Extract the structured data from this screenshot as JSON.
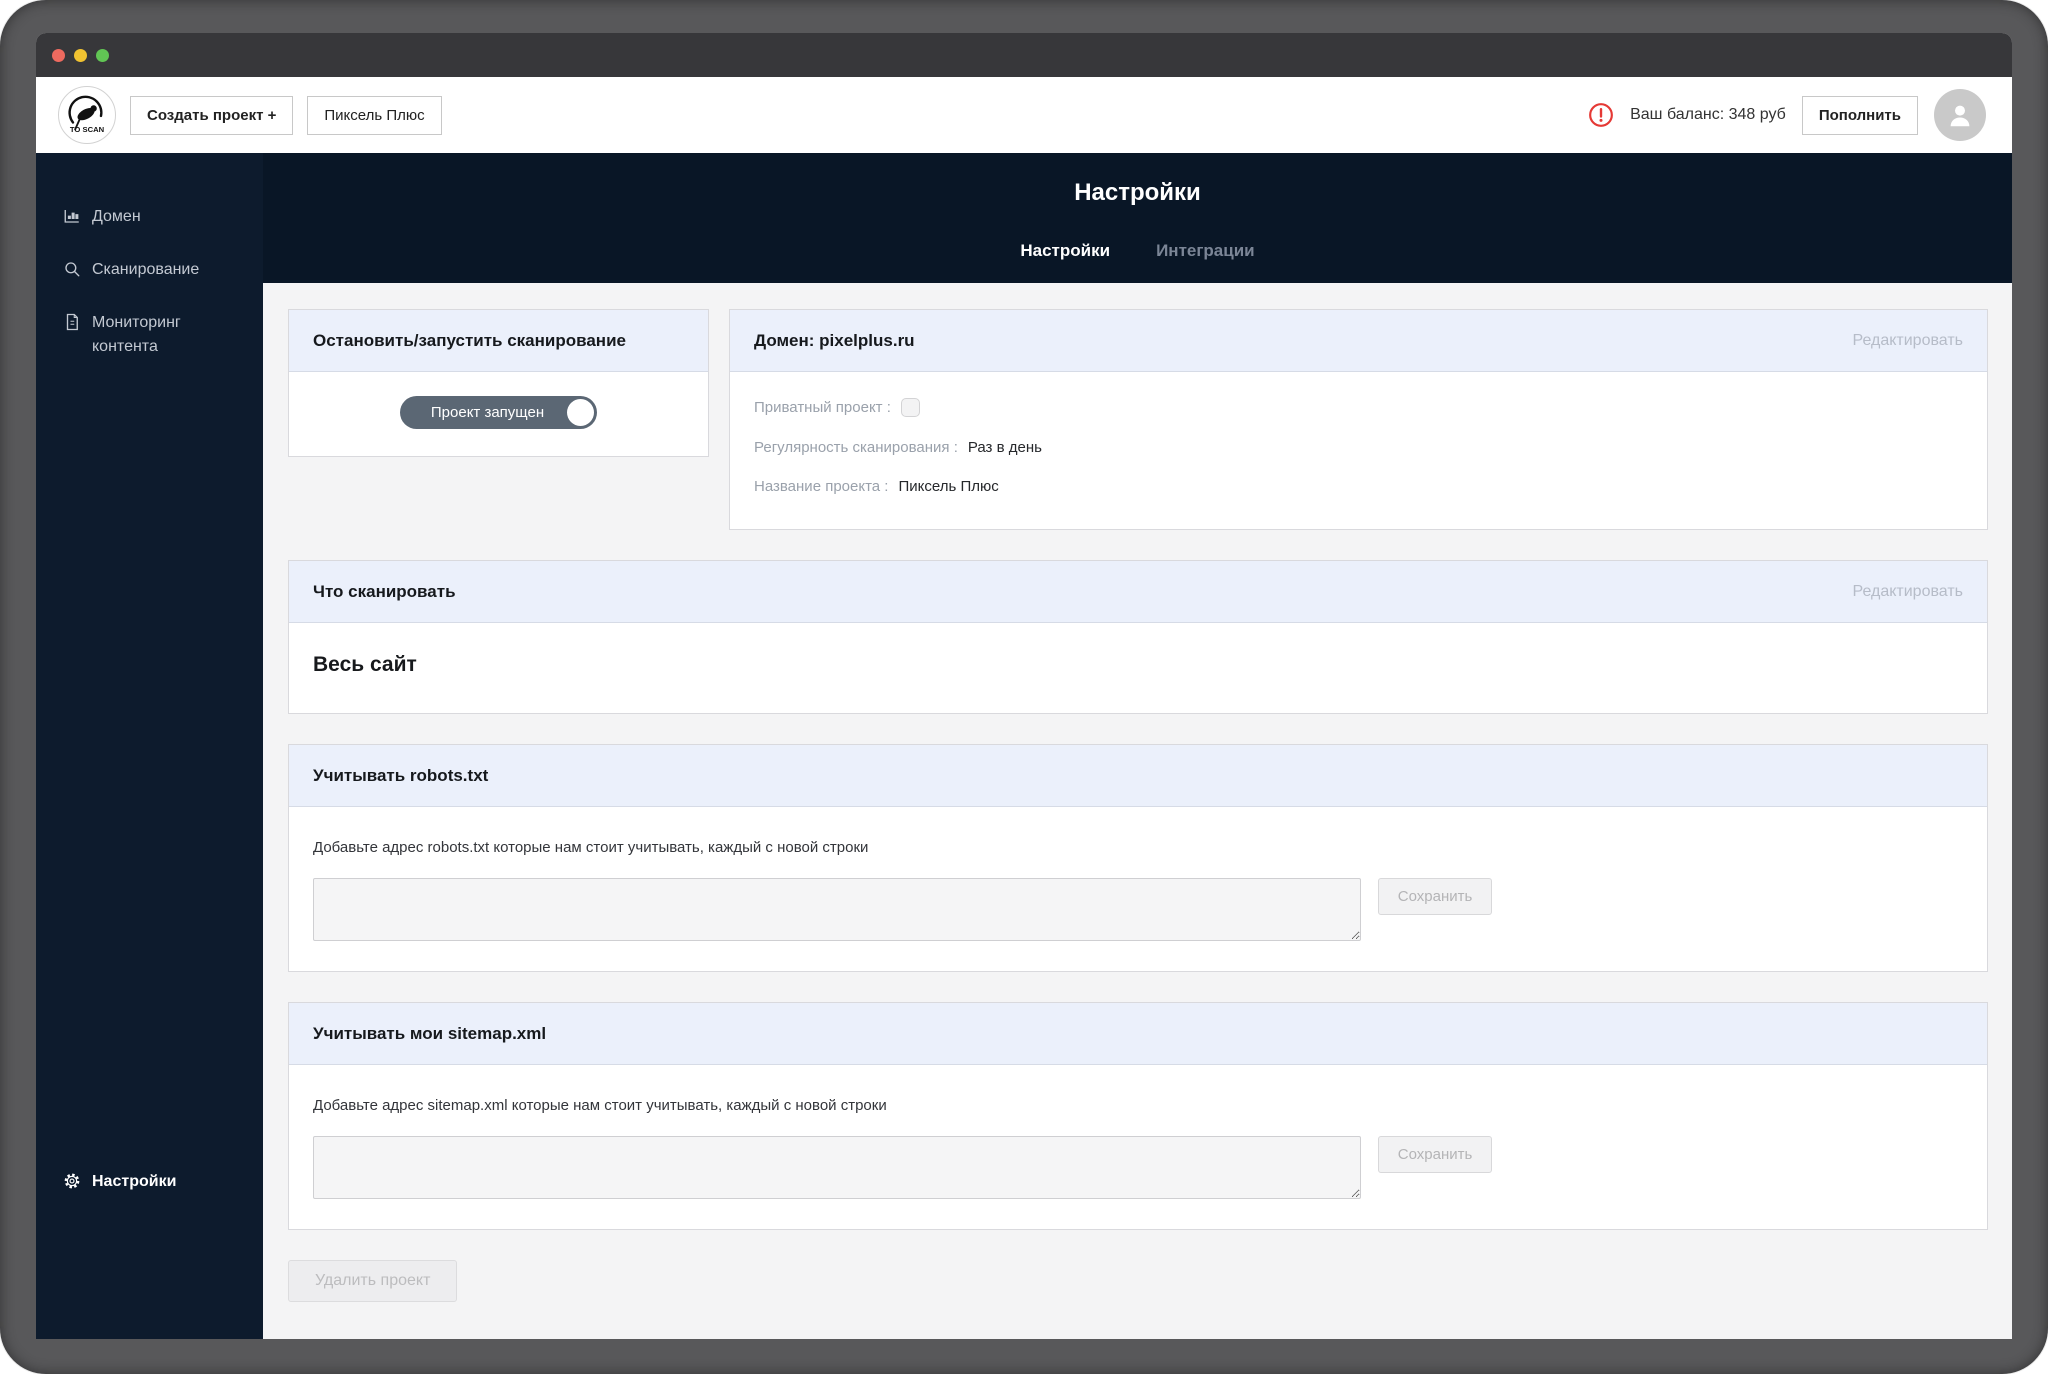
{
  "header": {
    "logo_text": "TO SCAN",
    "create_project_button": "Создать проект +",
    "project_button": "Пиксель Плюс",
    "balance_text": "Ваш баланс: 348 руб",
    "topup_button": "Пополнить",
    "balance_alert_icon": "alert-circle-icon",
    "avatar_icon": "user-icon"
  },
  "sidebar": {
    "items": [
      {
        "label": "Домен",
        "icon": "chart-icon",
        "active": false
      },
      {
        "label": "Сканирование",
        "icon": "search-icon",
        "active": false
      },
      {
        "label": "Мониторинг контента",
        "icon": "document-icon",
        "active": false
      },
      {
        "label": "Настройки",
        "icon": "gear-icon",
        "active": true
      }
    ]
  },
  "page": {
    "title": "Настройки",
    "tabs": [
      {
        "label": "Настройки",
        "active": true
      },
      {
        "label": "Интеграции",
        "active": false
      }
    ]
  },
  "cards": {
    "scan_toggle": {
      "title": "Остановить/запустить сканирование",
      "toggle_label": "Проект запущен",
      "toggle_on": true
    },
    "domain": {
      "title": "Домен: pixelplus.ru",
      "edit_link": "Редактировать",
      "private_label": "Приватный проект :",
      "private_checked": false,
      "frequency_label": "Регулярность сканирования :",
      "frequency_value": "Раз в день",
      "name_label": "Название проекта :",
      "name_value": "Пиксель Плюс"
    },
    "what_to_scan": {
      "title": "Что сканировать",
      "edit_link": "Редактировать",
      "value": "Весь сайт"
    },
    "robots": {
      "title": "Учитывать robots.txt",
      "description": "Добавьте адрес robots.txt которые нам стоит учитывать, каждый с новой строки",
      "textarea_value": "",
      "save_button": "Сохранить"
    },
    "sitemap": {
      "title": "Учитывать мои sitemap.xml",
      "description": "Добавьте адрес sitemap.xml которые нам стоит учитывать, каждый с новой строки",
      "textarea_value": "",
      "save_button": "Сохранить"
    }
  },
  "footer": {
    "delete_button": "Удалить проект"
  },
  "colors": {
    "sidebar_bg": "#0d1b2d",
    "banner_bg": "#091626",
    "card_header_bg": "#ebf0fb",
    "toggle_bg": "#5b6774",
    "alert_red": "#e53935",
    "content_bg": "#f4f4f5"
  }
}
